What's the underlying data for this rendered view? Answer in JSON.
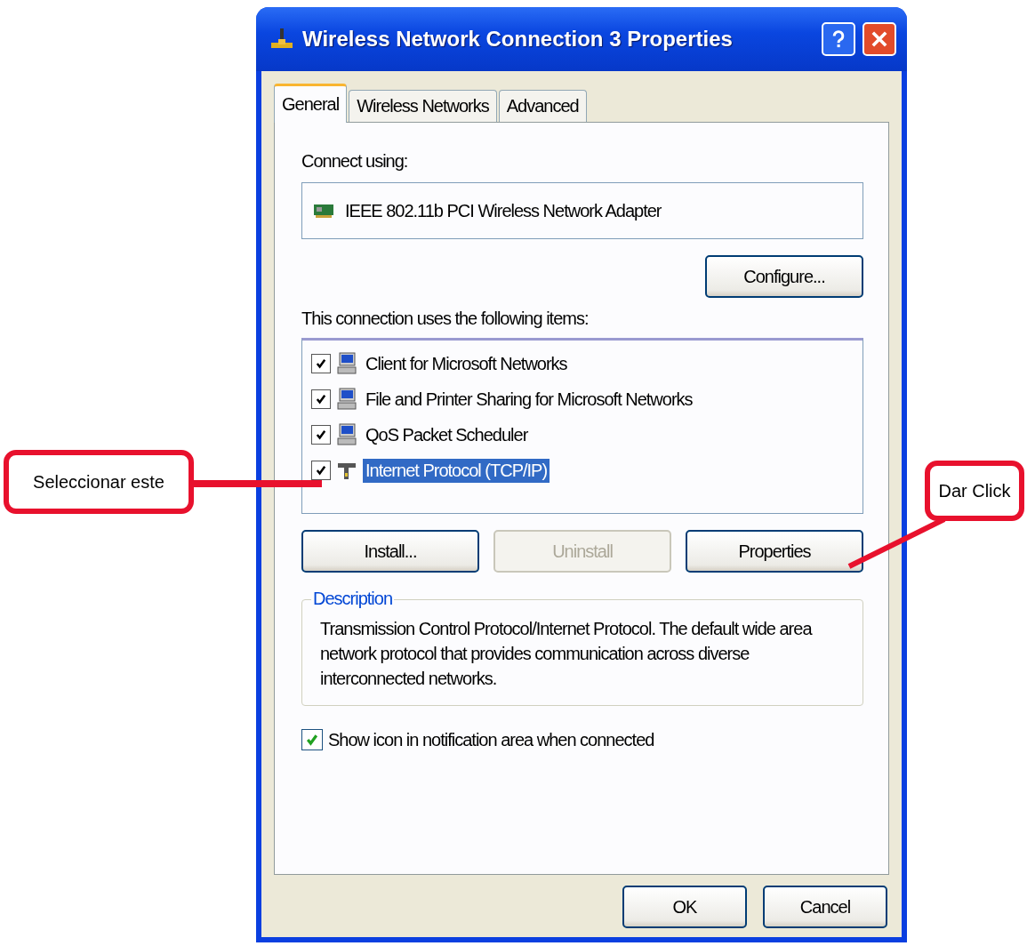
{
  "window": {
    "title": "Wireless Network Connection 3 Properties"
  },
  "tabs": [
    {
      "label": "General",
      "selected": true
    },
    {
      "label": "Wireless Networks",
      "selected": false
    },
    {
      "label": "Advanced",
      "selected": false
    }
  ],
  "connect_using": {
    "label": "Connect using:",
    "adapter": "IEEE 802.11b PCI Wireless Network Adapter",
    "button": "Configure..."
  },
  "items_label": "This connection uses the following items:",
  "items": [
    {
      "label": "Client for Microsoft Networks",
      "kind": "computer",
      "checked": true,
      "selected": false
    },
    {
      "label": "File and Printer Sharing for Microsoft Networks",
      "kind": "computer",
      "checked": true,
      "selected": false
    },
    {
      "label": "QoS Packet Scheduler",
      "kind": "computer",
      "checked": true,
      "selected": false
    },
    {
      "label": "Internet Protocol (TCP/IP)",
      "kind": "protocol",
      "checked": true,
      "selected": true
    }
  ],
  "item_buttons": [
    {
      "label": "Install...",
      "disabled": false
    },
    {
      "label": "Uninstall",
      "disabled": true
    },
    {
      "label": "Properties",
      "disabled": false
    }
  ],
  "description": {
    "label": "Description",
    "text": "Transmission Control Protocol/Internet Protocol. The default wide area network protocol that provides communication across diverse interconnected networks."
  },
  "show_icon": {
    "label": "Show icon in notification area when connected",
    "checked": true
  },
  "dialog_buttons": [
    "OK",
    "Cancel"
  ],
  "callouts": [
    {
      "text": "Seleccionar este"
    },
    {
      "text": "Dar Click"
    }
  ]
}
